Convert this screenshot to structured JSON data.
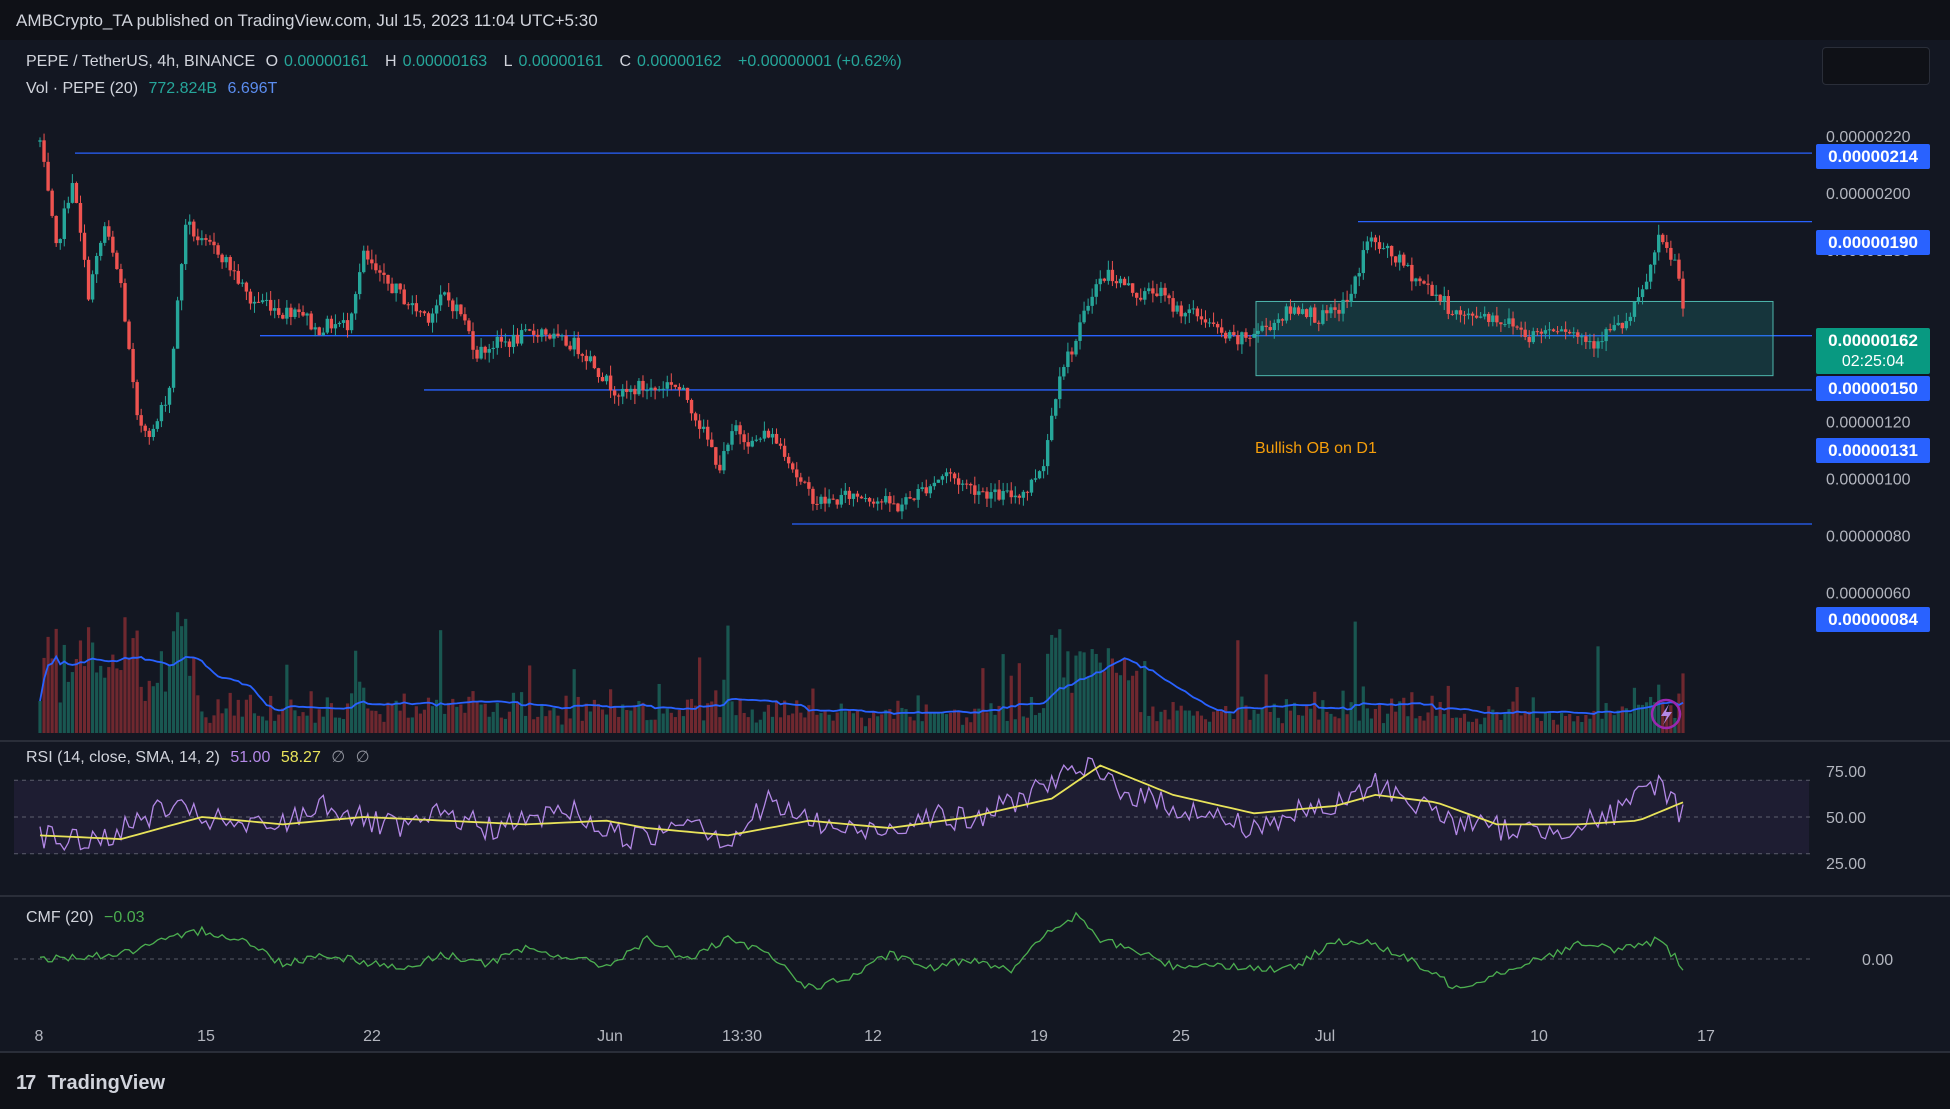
{
  "publisher": "AMBCrypto_TA published on TradingView.com, Jul 15, 2023 11:04 UTC+5:30",
  "legend": {
    "symbol": "PEPE / TetherUS, 4h, BINANCE",
    "open_label": "O",
    "open": "0.00000161",
    "high_label": "H",
    "high": "0.00000163",
    "low_label": "L",
    "low": "0.00000161",
    "close_label": "C",
    "close": "0.00000162",
    "change": "+0.00000001 (+0.62%)",
    "volume_label": "Vol · PEPE (20)",
    "volume": "772.824B",
    "volume_ma": "6.696T"
  },
  "rsi_legend": {
    "label": "RSI (14, close, SMA, 14, 2)",
    "value": "51.00",
    "ma": "58.27",
    "extra1": "∅",
    "extra2": "∅"
  },
  "cmf_legend": {
    "label": "CMF (20)",
    "value": "−0.03"
  },
  "footer": {
    "logo": "17",
    "brand": "TradingView"
  },
  "price_axis": {
    "ticks": [
      "0.00000220",
      "0.00000200",
      "0.00000180",
      "0.00000140",
      "0.00000120",
      "0.00000100",
      "0.00000080",
      "0.00000060"
    ],
    "tick_values": [
      220,
      200,
      180,
      140,
      120,
      100,
      80,
      60
    ]
  },
  "level_tags": [
    "0.00000214",
    "0.00000190",
    "0.00000150",
    "0.00000131",
    "0.00000084"
  ],
  "current_price": {
    "price": "0.00000162",
    "countdown": "02:25:04"
  },
  "order_block": {
    "label": "Bullish OB on D1"
  },
  "rsi_axis": {
    "ticks": [
      "75.00",
      "50.00",
      "25.00"
    ]
  },
  "cmf_axis": {
    "ticks": [
      "0.00"
    ]
  },
  "time_axis": {
    "labels": [
      "8",
      "15",
      "22",
      "Jun",
      "13:30",
      "12",
      "19",
      "25",
      "Jul",
      "10",
      "17"
    ]
  },
  "chart_data": {
    "type": "candlestick",
    "timeframe": "4h",
    "x_range": [
      "May 8",
      "Jul 15"
    ],
    "y_unit": "×1e-8 USDT",
    "ylim": [
      55,
      226
    ],
    "levels": [
      214,
      190,
      150,
      131,
      84
    ],
    "order_block_range": [
      136,
      162
    ],
    "path_points": [
      [
        0,
        218
      ],
      [
        4,
        180
      ],
      [
        8,
        205
      ],
      [
        12,
        165
      ],
      [
        16,
        188
      ],
      [
        20,
        168
      ],
      [
        24,
        120
      ],
      [
        28,
        116
      ],
      [
        32,
        132
      ],
      [
        36,
        190
      ],
      [
        40,
        182
      ],
      [
        44,
        180
      ],
      [
        48,
        172
      ],
      [
        52,
        162
      ],
      [
        56,
        162
      ],
      [
        60,
        158
      ],
      [
        64,
        160
      ],
      [
        68,
        152
      ],
      [
        72,
        154
      ],
      [
        76,
        154
      ],
      [
        80,
        178
      ],
      [
        84,
        170
      ],
      [
        88,
        166
      ],
      [
        92,
        160
      ],
      [
        96,
        157
      ],
      [
        100,
        164
      ],
      [
        104,
        158
      ],
      [
        108,
        144
      ],
      [
        112,
        147
      ],
      [
        116,
        148
      ],
      [
        120,
        150
      ],
      [
        124,
        152
      ],
      [
        128,
        148
      ],
      [
        132,
        147
      ],
      [
        136,
        142
      ],
      [
        140,
        134
      ],
      [
        144,
        129
      ],
      [
        148,
        132
      ],
      [
        152,
        131
      ],
      [
        156,
        134
      ],
      [
        160,
        128
      ],
      [
        164,
        116
      ],
      [
        168,
        104
      ],
      [
        172,
        118
      ],
      [
        176,
        112
      ],
      [
        180,
        116
      ],
      [
        184,
        110
      ],
      [
        188,
        98
      ],
      [
        192,
        92
      ],
      [
        196,
        92
      ],
      [
        200,
        94
      ],
      [
        204,
        94
      ],
      [
        208,
        92
      ],
      [
        212,
        90
      ],
      [
        216,
        94
      ],
      [
        220,
        98
      ],
      [
        224,
        102
      ],
      [
        228,
        98
      ],
      [
        232,
        96
      ],
      [
        236,
        94
      ],
      [
        240,
        94
      ],
      [
        244,
        96
      ],
      [
        248,
        106
      ],
      [
        252,
        138
      ],
      [
        256,
        148
      ],
      [
        260,
        166
      ],
      [
        264,
        172
      ],
      [
        268,
        168
      ],
      [
        272,
        164
      ],
      [
        276,
        166
      ],
      [
        280,
        160
      ],
      [
        284,
        158
      ],
      [
        288,
        156
      ],
      [
        292,
        150
      ],
      [
        296,
        148
      ],
      [
        300,
        151
      ],
      [
        304,
        154
      ],
      [
        308,
        158
      ],
      [
        312,
        160
      ],
      [
        316,
        156
      ],
      [
        320,
        158
      ],
      [
        324,
        164
      ],
      [
        328,
        184
      ],
      [
        332,
        180
      ],
      [
        336,
        176
      ],
      [
        340,
        170
      ],
      [
        344,
        166
      ],
      [
        348,
        160
      ],
      [
        352,
        156
      ],
      [
        356,
        158
      ],
      [
        360,
        156
      ],
      [
        364,
        154
      ],
      [
        368,
        150
      ],
      [
        372,
        152
      ],
      [
        376,
        154
      ],
      [
        380,
        150
      ],
      [
        384,
        148
      ],
      [
        388,
        152
      ],
      [
        392,
        154
      ],
      [
        396,
        165
      ],
      [
        400,
        183
      ],
      [
        404,
        176
      ],
      [
        406,
        162
      ]
    ],
    "rsi_band": [
      30,
      70
    ],
    "rsi_ylim": [
      10,
      90
    ],
    "rsi_points": [
      [
        0,
        40
      ],
      [
        10,
        36
      ],
      [
        20,
        42
      ],
      [
        30,
        55
      ],
      [
        40,
        50
      ],
      [
        50,
        44
      ],
      [
        60,
        46
      ],
      [
        70,
        58
      ],
      [
        80,
        48
      ],
      [
        90,
        43
      ],
      [
        100,
        52
      ],
      [
        110,
        44
      ],
      [
        120,
        47
      ],
      [
        130,
        55
      ],
      [
        140,
        42
      ],
      [
        150,
        38
      ],
      [
        160,
        52
      ],
      [
        170,
        36
      ],
      [
        180,
        58
      ],
      [
        190,
        48
      ],
      [
        200,
        42
      ],
      [
        210,
        44
      ],
      [
        220,
        52
      ],
      [
        230,
        47
      ],
      [
        240,
        58
      ],
      [
        250,
        70
      ],
      [
        260,
        76
      ],
      [
        270,
        62
      ],
      [
        280,
        56
      ],
      [
        290,
        50
      ],
      [
        300,
        44
      ],
      [
        310,
        52
      ],
      [
        320,
        55
      ],
      [
        330,
        68
      ],
      [
        340,
        58
      ],
      [
        350,
        47
      ],
      [
        360,
        44
      ],
      [
        370,
        42
      ],
      [
        380,
        46
      ],
      [
        390,
        52
      ],
      [
        400,
        70
      ],
      [
        406,
        51
      ]
    ],
    "rsi_ma_points": [
      [
        0,
        40
      ],
      [
        20,
        38
      ],
      [
        40,
        50
      ],
      [
        60,
        46
      ],
      [
        80,
        50
      ],
      [
        100,
        48
      ],
      [
        120,
        46
      ],
      [
        140,
        48
      ],
      [
        150,
        44
      ],
      [
        170,
        40
      ],
      [
        190,
        48
      ],
      [
        210,
        44
      ],
      [
        230,
        50
      ],
      [
        250,
        60
      ],
      [
        262,
        78
      ],
      [
        280,
        62
      ],
      [
        300,
        52
      ],
      [
        320,
        56
      ],
      [
        330,
        62
      ],
      [
        345,
        58
      ],
      [
        360,
        46
      ],
      [
        380,
        46
      ],
      [
        395,
        48
      ],
      [
        406,
        58
      ]
    ],
    "cmf_ylim": [
      -0.3,
      0.3
    ],
    "cmf_points": [
      [
        0,
        0.0
      ],
      [
        20,
        0.02
      ],
      [
        40,
        0.12
      ],
      [
        50,
        0.08
      ],
      [
        60,
        -0.02
      ],
      [
        70,
        0.02
      ],
      [
        80,
        -0.01
      ],
      [
        90,
        -0.04
      ],
      [
        100,
        0.02
      ],
      [
        110,
        -0.02
      ],
      [
        120,
        0.04
      ],
      [
        130,
        0.01
      ],
      [
        140,
        -0.03
      ],
      [
        150,
        0.08
      ],
      [
        160,
        0.0
      ],
      [
        170,
        0.08
      ],
      [
        180,
        0.02
      ],
      [
        190,
        -0.12
      ],
      [
        200,
        -0.08
      ],
      [
        210,
        0.02
      ],
      [
        220,
        -0.04
      ],
      [
        230,
        0.0
      ],
      [
        240,
        -0.04
      ],
      [
        250,
        0.12
      ],
      [
        256,
        0.18
      ],
      [
        262,
        0.08
      ],
      [
        270,
        0.04
      ],
      [
        280,
        -0.03
      ],
      [
        290,
        -0.02
      ],
      [
        300,
        -0.04
      ],
      [
        310,
        -0.04
      ],
      [
        320,
        0.08
      ],
      [
        330,
        0.06
      ],
      [
        340,
        -0.02
      ],
      [
        350,
        -0.12
      ],
      [
        360,
        -0.06
      ],
      [
        370,
        0.0
      ],
      [
        380,
        0.06
      ],
      [
        390,
        0.04
      ],
      [
        400,
        0.08
      ],
      [
        406,
        -0.03
      ]
    ]
  }
}
